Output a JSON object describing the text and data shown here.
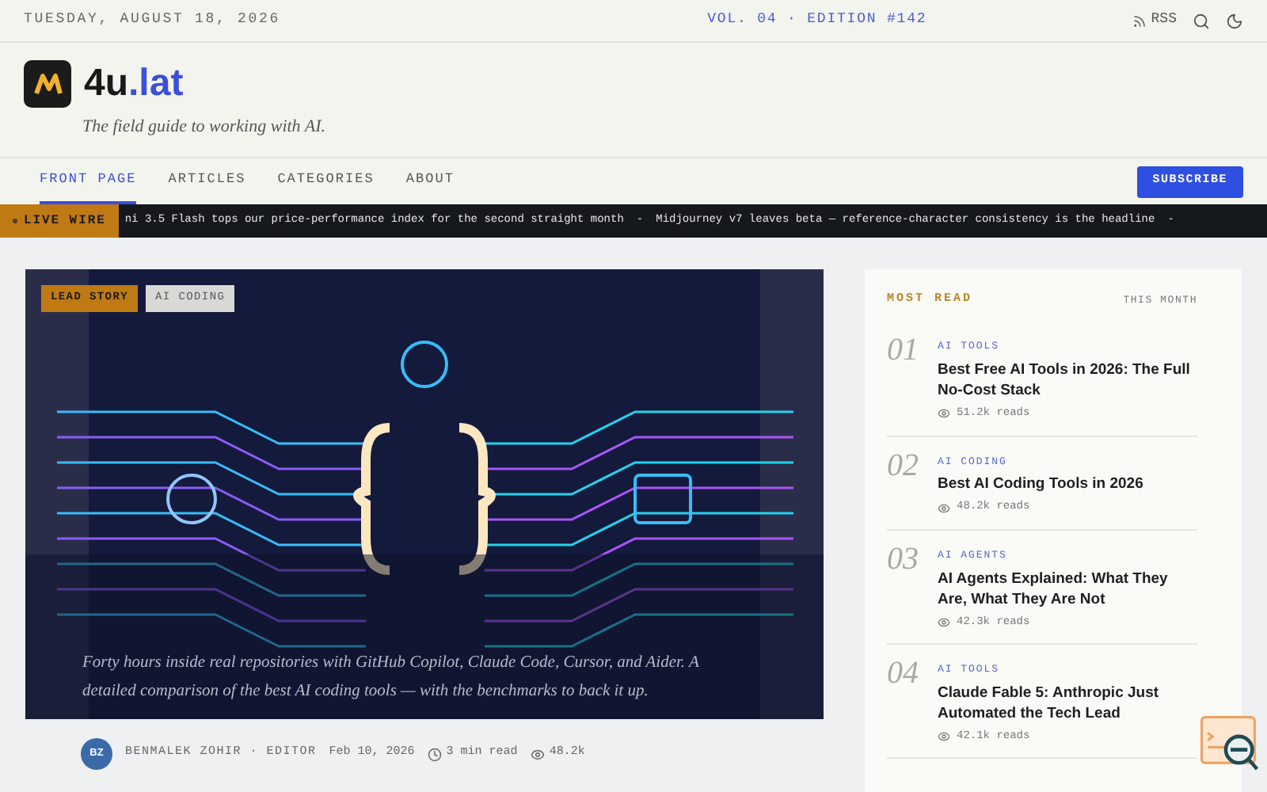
{
  "top_bar": {
    "date": "TUESDAY, AUGUST 18, 2026",
    "edition": "VOL. 04 · EDITION #142",
    "rss": "RSS"
  },
  "brand": {
    "name": "4u",
    "accent": ".lat",
    "tagline": "The field guide to working with AI."
  },
  "nav": {
    "items": [
      {
        "label": "FRONT PAGE",
        "selected": true
      },
      {
        "label": "ARTICLES",
        "selected": false
      },
      {
        "label": "CATEGORIES",
        "selected": false
      },
      {
        "label": "ABOUT",
        "selected": false
      }
    ],
    "subscribe": "SUBSCRIBE"
  },
  "ticker": {
    "label": "LIVE WIRE",
    "items": [
      "ni 3.5 Flash tops our price-performance index for the second straight month",
      "-",
      "Midjourney v7 leaves beta — reference-character consistency is the headline",
      "-"
    ]
  },
  "lead": {
    "tags": [
      "LEAD STORY",
      "AI CODING"
    ],
    "excerpt": "Forty hours inside real repositories with GitHub Copilot, Claude Code, Cursor, and Aider. A detailed comparison of the best AI coding tools — with the benchmarks to back it up.",
    "author_initials": "BZ",
    "author": "BENMALEK ZOHIR · EDITOR",
    "date": "Feb 10, 2026",
    "read_time": "3 min read",
    "views": "48.2k"
  },
  "most_read": {
    "title": "MOST READ",
    "period": "THIS MONTH",
    "items": [
      {
        "number": "01",
        "category": "AI TOOLS",
        "title": "Best Free AI Tools in 2026: The Full No-Cost Stack",
        "reads": "51.2k reads"
      },
      {
        "number": "02",
        "category": "AI CODING",
        "title": "Best AI Coding Tools in 2026",
        "reads": "48.2k reads"
      },
      {
        "number": "03",
        "category": "AI AGENTS",
        "title": "AI Agents Explained: What They Are, What They Are Not",
        "reads": "42.3k reads"
      },
      {
        "number": "04",
        "category": "AI TOOLS",
        "title": "Claude Fable 5: Anthropic Just Automated the Tech Lead",
        "reads": "42.1k reads"
      }
    ]
  }
}
